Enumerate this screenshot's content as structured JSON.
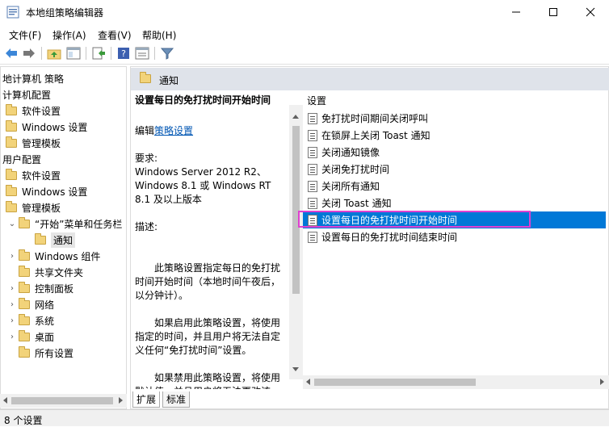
{
  "window": {
    "title": "本地组策略编辑器",
    "controls": [
      "minimize",
      "maximize",
      "close"
    ]
  },
  "menu": [
    {
      "label": "文件(F)"
    },
    {
      "label": "操作(A)"
    },
    {
      "label": "查看(V)"
    },
    {
      "label": "帮助(H)"
    }
  ],
  "tree": {
    "items": [
      {
        "label": "地计算机 策略",
        "level": 0,
        "chev": "",
        "folder": false
      },
      {
        "label": "计算机配置",
        "level": 0,
        "chev": "",
        "folder": false
      },
      {
        "label": "软件设置",
        "level": 1,
        "chev": "",
        "folder": true
      },
      {
        "label": "Windows 设置",
        "level": 1,
        "chev": "",
        "folder": true
      },
      {
        "label": "管理模板",
        "level": 1,
        "chev": "",
        "folder": true
      },
      {
        "label": "用户配置",
        "level": 0,
        "chev": "",
        "folder": false
      },
      {
        "label": "软件设置",
        "level": 1,
        "chev": "",
        "folder": true
      },
      {
        "label": "Windows 设置",
        "level": 1,
        "chev": "",
        "folder": true
      },
      {
        "label": "管理模板",
        "level": 1,
        "chev": "",
        "folder": true
      },
      {
        "label": "“开始”菜单和任务栏",
        "level": 2,
        "chev": "v",
        "folder": true
      },
      {
        "label": "通知",
        "level": 3,
        "chev": "",
        "folder": true,
        "selected": true
      },
      {
        "label": "Windows 组件",
        "level": 2,
        "chev": ">",
        "folder": true
      },
      {
        "label": "共享文件夹",
        "level": 2,
        "chev": "",
        "folder": true
      },
      {
        "label": "控制面板",
        "level": 2,
        "chev": ">",
        "folder": true
      },
      {
        "label": "网络",
        "level": 2,
        "chev": ">",
        "folder": true
      },
      {
        "label": "系统",
        "level": 2,
        "chev": ">",
        "folder": true
      },
      {
        "label": "桌面",
        "level": 2,
        "chev": ">",
        "folder": true
      },
      {
        "label": "所有设置",
        "level": 2,
        "chev": "",
        "folder": true
      }
    ]
  },
  "pane": {
    "title": "通知"
  },
  "description": {
    "heading": "设置每日的免打扰时间开始时间",
    "edit_prefix": "编辑",
    "edit_link": "策略设置",
    "requirements_label": "要求:",
    "requirements_text": "Windows Server 2012 R2、Windows 8.1 或 Windows RT 8.1 及以上版本",
    "desc_label": "描述:",
    "para1": "此策略设置指定每日的免打扰时间开始时间（本地时间午夜后，以分钟计）。",
    "para2": "如果启用此策略设置，将使用指定的时间，并且用户将无法自定义任何“免打扰时间”设置。",
    "para3": "如果禁用此策略设置，将使用默认值，并且用户将无法更改该"
  },
  "list": {
    "header": "设置",
    "items": [
      {
        "label": "免打扰时间期间关闭呼叫"
      },
      {
        "label": "在锁屏上关闭 Toast 通知"
      },
      {
        "label": "关闭通知镜像"
      },
      {
        "label": "关闭免打扰时间"
      },
      {
        "label": "关闭所有通知"
      },
      {
        "label": "关闭 Toast 通知"
      },
      {
        "label": "设置每日的免打扰时间开始时间",
        "selected": true
      },
      {
        "label": "设置每日的免打扰时间结束时间"
      }
    ]
  },
  "tabs": [
    {
      "label": "扩展"
    },
    {
      "label": "标准"
    }
  ],
  "status": {
    "text": "8 个设置"
  },
  "colors": {
    "selection": "#0078d7",
    "highlight": "#e040d0",
    "header": "#dfe3ea"
  }
}
